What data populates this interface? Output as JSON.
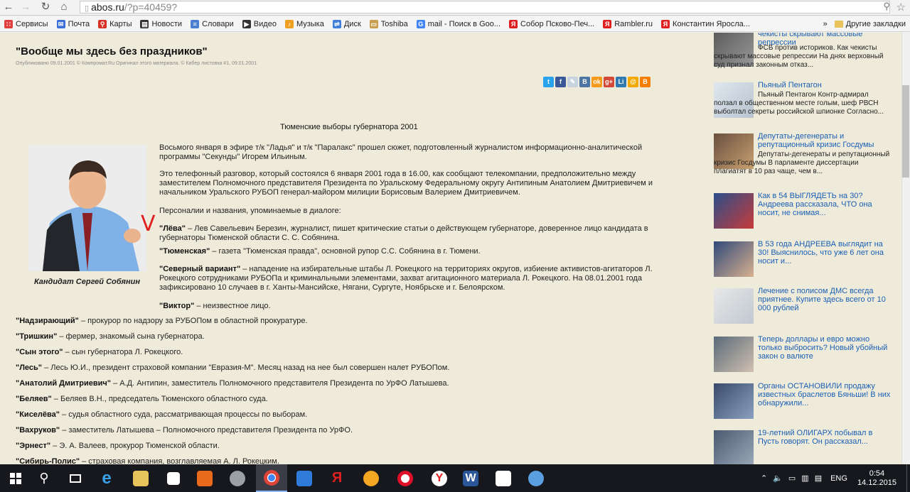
{
  "browser": {
    "host": "abos.ru",
    "path": "/?p=40459?"
  },
  "bookmarks": [
    {
      "label": "Сервисы",
      "color": "#e04040",
      "glyph": "∷"
    },
    {
      "label": "Почта",
      "color": "#3c6fd9",
      "glyph": "✉"
    },
    {
      "label": "Карты",
      "color": "#d93025",
      "glyph": "⚲"
    },
    {
      "label": "Новости",
      "color": "#333333",
      "glyph": "▤"
    },
    {
      "label": "Словари",
      "color": "#4a7fd0",
      "glyph": "≡"
    },
    {
      "label": "Видео",
      "color": "#333333",
      "glyph": "▶"
    },
    {
      "label": "Музыка",
      "color": "#f0a020",
      "glyph": "♪"
    },
    {
      "label": "Диск",
      "color": "#3f7fd9",
      "glyph": "⇌"
    },
    {
      "label": "Toshiba",
      "color": "#c9a050",
      "glyph": "▭"
    },
    {
      "label": "mail - Поиск в Goo...",
      "color": "#4285f4",
      "glyph": "G"
    },
    {
      "label": "Собор Псково-Печ...",
      "color": "#e02020",
      "glyph": "Я"
    },
    {
      "label": "Rambler.ru",
      "color": "#e02020",
      "glyph": "Я"
    },
    {
      "label": "Константин Яросла...",
      "color": "#e02020",
      "glyph": "Я"
    }
  ],
  "bookmarks_more": "»",
  "bookmarks_other": "Другие закладки",
  "article": {
    "title": "\"Вообще мы здесь без праздников\"",
    "meta": "Опубликовано 09.01.2001 © Компромат.Ru Оригинал этого материала. © Кибер листовка #1, 09.01.2001",
    "subtitle": "Тюменские выборы губернатора 2001",
    "photo_caption": "Кандидат Сергей Собянин",
    "p1": "Восьмого января в эфире т/к \"Ладья\" и т/к \"Паралакс\" прошел сюжет, подготовленный журналистом информационно-аналитической программы \"Секунды\" Игорем Ильиным.",
    "p2": "Это телефонный разговор, который состоялся 6 января 2001 года в 16.00, как сообщают телекомпании, предположительно между заместителем Полномочного представителя Президента по Уральскому Федеральному округу Антипиным Анатолием Дмитриевичем и начальником Уральского РУБОП генерал-майором милиции Борисовым Валерием Дмитриевичем.",
    "p3": "Персоналии и названия, упоминаемые в диалоге:",
    "defs": [
      {
        "term": "\"Лёва\"",
        "text": " – Лев Савельевич Березин, журналист, пишет критические статьи о действующем губернаторе, доверенное лицо кандидата в губернаторы Тюменской области С. С. Собянина."
      },
      {
        "term": "\"Тюменская\"",
        "text": " – газета \"Тюменская правда\", основной рупор С.С. Собянина в г. Тюмени."
      },
      {
        "term": "\"Северный вариант\"",
        "text": " – нападение на избирательные штабы Л. Рокецкого на территориях округов, избиение активистов-агитаторов Л. Рокецкого сотрудниками РУБОПа и криминальными элементами, захват агитационного материала Л. Рокецкого. На 08.01.2001 года зафиксировано 10 случаев в г. Ханты-Мансийске, Нягани, Сургуте, Ноябрьске и г. Белоярском."
      },
      {
        "term": "\"Виктор\"",
        "text": " – неизвестное лицо."
      },
      {
        "term": "\"Надзирающий\"",
        "text": " – прокурор по надзору за РУБОПом в областной прокуратуре."
      },
      {
        "term": "\"Тришкин\"",
        "text": " – фермер, знакомый сына губернатора."
      },
      {
        "term": "\"Сын этого\"",
        "text": " – сын губернатора Л. Рокецкого."
      },
      {
        "term": "\"Лесь\"",
        "text": " – Лесь Ю.И., президент страховой компании \"Евразия-М\". Месяц назад на нее был совершен налет РУБОПом."
      },
      {
        "term": "\"Анатолий Дмитриевич\"",
        "text": " – А.Д. Антипин, заместитель Полномочного представителя Президента по УрФО Латышева."
      },
      {
        "term": "\"Беляев\"",
        "text": " – Беляев В.Н., председатель Тюменского областного суда."
      },
      {
        "term": "\"Киселёва\"",
        "text": " – судья областного суда, рассматривающая процессы по выборам."
      },
      {
        "term": "\"Вахруков\"",
        "text": " – заместитель Латышева – Полномочного представителя Президента по УрФО."
      },
      {
        "term": "\"Эрнест\"",
        "text": " – Э. А. Валеев, прокурор Тюменской области."
      },
      {
        "term": "\"Сибирь-Полис\"",
        "text": " – страховая компания, возглавляемая А. Л. Рокецким."
      }
    ]
  },
  "share_icons": [
    {
      "name": "twitter-share-icon",
      "glyph": "t",
      "color": "#2aa3ef"
    },
    {
      "name": "facebook-share-icon",
      "glyph": "f",
      "color": "#3b5998"
    },
    {
      "name": "livejournal-share-icon",
      "glyph": "✎",
      "color": "#c8d3e0"
    },
    {
      "name": "vk-share-icon",
      "glyph": "B",
      "color": "#4c75a3"
    },
    {
      "name": "odnoklassniki-share-icon",
      "glyph": "ok",
      "color": "#f59a1b"
    },
    {
      "name": "googleplus-share-icon",
      "glyph": "g+",
      "color": "#d34836"
    },
    {
      "name": "liveinternet-share-icon",
      "glyph": "Li",
      "color": "#2f79b0"
    },
    {
      "name": "mailru-share-icon",
      "glyph": "@",
      "color": "#f2a900"
    },
    {
      "name": "blogger-share-icon",
      "glyph": "B",
      "color": "#f57d00"
    }
  ],
  "sidebar": [
    {
      "title": "чекисты скрывают массовые репрессии",
      "desc": "ФСБ против историков. Как чекисты скрывают массовые репрессии На днях верховный суд признал законным отказ..."
    },
    {
      "title": "Пьяный Пентагон",
      "desc": "Пьяный Пентагон Контр-адмирал ползал в общественном месте голым, шеф РВСН выболтал секреты российской шпионке Согласно..."
    },
    {
      "title": "Депутаты-дегенераты и репутационный кризис Госдумы",
      "desc": "Депутаты-дегенераты и репутационный кризис Госдумы В парламенте диссертации плагиатят в 10 раз чаще, чем в..."
    },
    {
      "title": "Как в 54 ВЫГЛЯДЕТЬ на 30? Андреева рассказала, ЧТО она носит, не снимая...",
      "desc": ""
    },
    {
      "title": "В 53 года АНДРЕЕВА выглядит на 30! Выяснилось, что уже 6 лет она носит и...",
      "desc": ""
    },
    {
      "title": "Лечение с полисом ДМС всегда приятнее. Купите здесь всего от 10 000 рублей",
      "desc": ""
    },
    {
      "title": "Теперь доллары и евро можно только выбросить? Новый убойный закон о валюте",
      "desc": ""
    },
    {
      "title": "Органы ОСТАНОВИЛИ продажу известных браслетов Бяньши! В них обнаружили...",
      "desc": ""
    },
    {
      "title": "19-летний ОЛИГАРХ побывал в Пусть говорят. Он рассказал...",
      "desc": ""
    }
  ],
  "taskbar": {
    "lang": "ENG",
    "time": "0:54",
    "date": "14.12.2015"
  }
}
